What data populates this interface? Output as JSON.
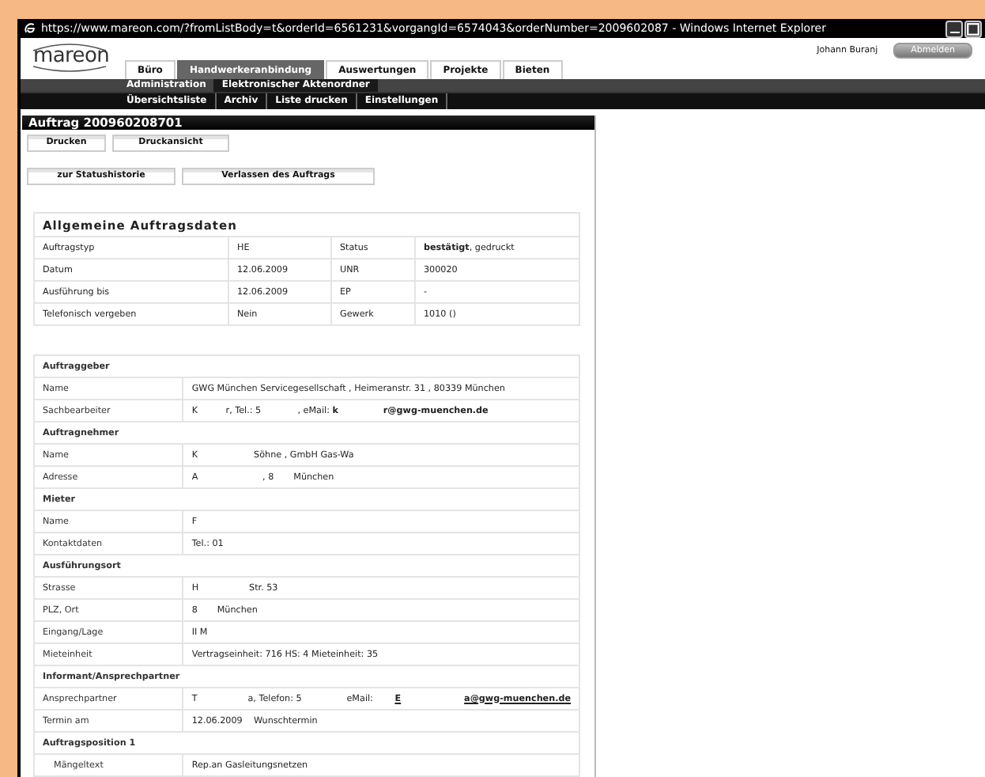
{
  "window": {
    "title": "https://www.mareon.com/?fromListBody=t&orderId=6561231&vorgangId=6574043&orderNumber=2009602087 - Windows Internet Explorer"
  },
  "header": {
    "logo": "mareon",
    "user": "Johann Buranj",
    "logout": "Abmelden"
  },
  "tabs": [
    {
      "label": "Büro",
      "selected": false
    },
    {
      "label": "Handwerkeranbindung",
      "selected": true
    },
    {
      "label": "Auswertungen",
      "selected": false
    },
    {
      "label": "Projekte",
      "selected": false
    },
    {
      "label": "Bieten",
      "selected": false
    }
  ],
  "subtabs": [
    {
      "label": "Administration",
      "selected": false
    },
    {
      "label": "Elektronischer Aktenordner",
      "selected": true
    }
  ],
  "subnav": [
    "Übersichtsliste",
    "Archiv",
    "Liste drucken",
    "Einstellungen"
  ],
  "order": {
    "title": "Auftrag 200960208701",
    "buttons": [
      [
        "Drucken",
        "Druckansicht"
      ],
      [
        "zur Statushistorie",
        "Verlassen des Auftrags"
      ]
    ],
    "general": {
      "title": "Allgemeine Auftragsdaten",
      "rows": [
        [
          "Auftragstyp",
          "HE",
          "Status",
          "**bestätigt**, gedruckt"
        ],
        [
          "Datum",
          "12.06.2009",
          "UNR",
          "300020"
        ],
        [
          "Ausführung bis",
          "12.06.2009",
          "EP",
          "-"
        ],
        [
          "Telefonisch vergeben",
          "Nein",
          "Gewerk",
          "1010 ()"
        ]
      ]
    },
    "details": [
      {
        "kind": "heading",
        "label": "Auftraggeber"
      },
      {
        "kind": "field",
        "label": "Name",
        "value": "GWG München Servicegesellschaft , Heimeranstr. 31 , 80339 München"
      },
      {
        "kind": "field",
        "label": "Sachbearbeiter",
        "value": "K          r, Tel.: 5             , eMail: **k**                **r@gwg-muenchen.de**"
      },
      {
        "kind": "heading",
        "label": "Auftragnehmer"
      },
      {
        "kind": "field",
        "label": "Name",
        "value": "K                    Söhne , GmbH Gas-Wa"
      },
      {
        "kind": "field",
        "label": "Adresse",
        "value": "A                       , 8       München"
      },
      {
        "kind": "heading",
        "label": "Mieter"
      },
      {
        "kind": "field",
        "label": "Name",
        "value": "F"
      },
      {
        "kind": "field",
        "label": "Kontaktdaten",
        "value": "Tel.: 01"
      },
      {
        "kind": "heading",
        "label": "Ausführungsort"
      },
      {
        "kind": "field",
        "label": "Strasse",
        "value": "H                  Str. 53"
      },
      {
        "kind": "field",
        "label": "PLZ, Ort",
        "value": "8       München"
      },
      {
        "kind": "field",
        "label": "Eingang/Lage",
        "value": "II M"
      },
      {
        "kind": "field",
        "label": "Mieteinheit",
        "value": "Vertragseinheit: 716 HS: 4 Mieteinheit: 35"
      },
      {
        "kind": "heading",
        "label": "Informant/Ansprechpartner"
      },
      {
        "kind": "field",
        "label": "Ansprechpartner",
        "value": "T                  a, Telefon: 5                eMail:",
        "links": [
          "E",
          "a@gwg-muenchen.de"
        ]
      },
      {
        "kind": "field",
        "label": "Termin am",
        "value": "12.06.2009    Wunschtermin"
      },
      {
        "kind": "heading",
        "label": "Auftragsposition 1"
      },
      {
        "kind": "field",
        "label": "Mängeltext",
        "value": "Rep.an Gasleitungsnetzen",
        "indent": true
      }
    ]
  }
}
